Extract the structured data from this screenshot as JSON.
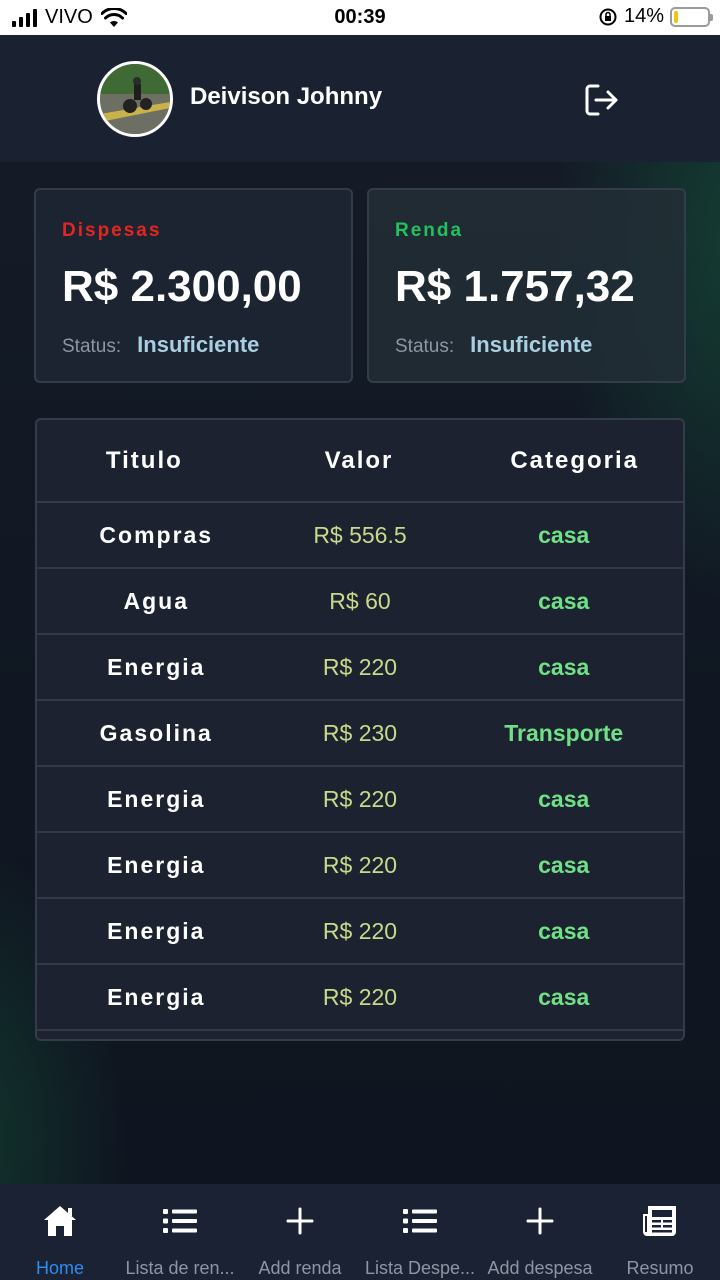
{
  "status_bar": {
    "carrier": "VIVO",
    "time": "00:39",
    "battery_percent": "14%",
    "battery_level": 0.14
  },
  "header": {
    "user_name": "Deivison Johnny",
    "logout_icon": "logout-icon"
  },
  "cards": {
    "expenses": {
      "label": "Dispesas",
      "amount": "R$ 2.300,00",
      "status_key": "Status:",
      "status_value": "Insuficiente",
      "color": "#e3261f"
    },
    "income": {
      "label": "Renda",
      "amount": "R$ 1.757,32",
      "status_key": "Status:",
      "status_value": "Insuficiente",
      "color": "#22c15e"
    }
  },
  "table": {
    "headers": [
      "Titulo",
      "Valor",
      "Categoria"
    ],
    "rows": [
      {
        "title": "Compras",
        "value": "R$ 556.5",
        "category": "casa"
      },
      {
        "title": "Agua",
        "value": "R$ 60",
        "category": "casa"
      },
      {
        "title": "Energia",
        "value": "R$ 220",
        "category": "casa"
      },
      {
        "title": "Gasolina",
        "value": "R$ 230",
        "category": "Transporte"
      },
      {
        "title": "Energia",
        "value": "R$ 220",
        "category": "casa"
      },
      {
        "title": "Energia",
        "value": "R$ 220",
        "category": "casa"
      },
      {
        "title": "Energia",
        "value": "R$ 220",
        "category": "casa"
      },
      {
        "title": "Energia",
        "value": "R$ 220",
        "category": "casa"
      }
    ]
  },
  "bottom_nav": {
    "active_color": "#2f8cf0",
    "items": [
      {
        "label": "Home",
        "icon": "home-icon"
      },
      {
        "label": "Lista de ren...",
        "icon": "list-icon"
      },
      {
        "label": "Add renda",
        "icon": "plus-icon"
      },
      {
        "label": "Lista Despe...",
        "icon": "list-icon"
      },
      {
        "label": "Add despesa",
        "icon": "plus-icon"
      },
      {
        "label": "Resumo",
        "icon": "newspaper-icon"
      }
    ]
  }
}
